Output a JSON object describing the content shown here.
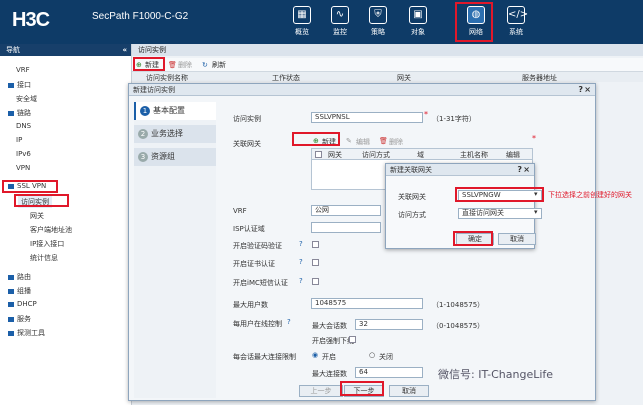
{
  "header": {
    "logo": "H3C",
    "product": "SecPath F1000-C-G2",
    "nav": [
      {
        "label": "概览",
        "icon": "overview-icon",
        "glyph": "▦"
      },
      {
        "label": "监控",
        "icon": "monitor-icon",
        "glyph": "∿"
      },
      {
        "label": "策略",
        "icon": "shield-icon",
        "glyph": "⛨"
      },
      {
        "label": "对象",
        "icon": "object-icon",
        "glyph": "▣"
      },
      {
        "label": "网络",
        "icon": "globe-icon",
        "glyph": "◍"
      },
      {
        "label": "系统",
        "icon": "code-icon",
        "glyph": "</>"
      }
    ]
  },
  "sidebar": {
    "title": "导航",
    "collapse": "«",
    "items": [
      "VRF",
      "接口",
      "安全域",
      "链路",
      "DNS",
      "IP",
      "IPv6",
      "VPN",
      "SSL VPN",
      "访问实例",
      "网关",
      "客户端地址池",
      "IP接入接口",
      "统计信息",
      "路由",
      "组播",
      "DHCP",
      "服务",
      "探测工具"
    ]
  },
  "main": {
    "tab": "访问实例",
    "toolbar": {
      "new": "新建",
      "delete": "删除",
      "refresh": "刷新"
    },
    "columns": [
      "访问实例名称",
      "工作状态",
      "网关",
      "服务器地址"
    ]
  },
  "dialog": {
    "title": "新建访问实例",
    "help": "?",
    "close": "×",
    "steps": [
      {
        "num": "1",
        "label": "基本配置"
      },
      {
        "num": "2",
        "label": "业务选择"
      },
      {
        "num": "3",
        "label": "资源组"
      }
    ],
    "instance_label": "访问实例",
    "instance_value": "SSLVPNSL",
    "instance_hint": "（1-31字符）",
    "gateway_label": "关联网关",
    "gw_new": "新建",
    "gw_edit": "编辑",
    "gw_delete": "删除",
    "gw_columns": [
      "网关",
      "访问方式",
      "域",
      "主机名称",
      "编辑"
    ],
    "vrf_label": "VRF",
    "vrf_value": "公网",
    "isp_label": "ISP认证域",
    "captcha_label": "开启验证码验证",
    "cert_label": "开启证书认证",
    "imc_label": "开启iMC短信认证",
    "max_users_label": "最大用户数",
    "max_users_value": "1048575",
    "max_users_hint": "（1-1048575）",
    "per_user_label": "每用户在线控制",
    "max_sessions_label": "最大会话数",
    "max_sessions_value": "32",
    "max_sessions_hint": "（0-1048575）",
    "force_offline_label": "开启强制下线",
    "per_session_label": "每会话最大连接限制",
    "on_label": "开启",
    "off_label": "关闭",
    "max_conn_label": "最大连接数",
    "max_conn_value": "64",
    "prev": "上一步",
    "next": "下一步",
    "cancel": "取消"
  },
  "subdialog": {
    "title": "新建关联网关",
    "help": "?",
    "close": "×",
    "gateway_label": "关联网关",
    "gateway_value": "SSLVPNGW",
    "access_label": "访问方式",
    "access_value": "直接访问网关",
    "ok": "确定",
    "cancel": "取消"
  },
  "annotation": "下拉选择之前创建好的网关",
  "watermark": "微信号: IT-ChangeLife",
  "colors": {
    "header": "#0e3b67",
    "highlight": "#e0182a",
    "accent": "#1b5fa8"
  }
}
